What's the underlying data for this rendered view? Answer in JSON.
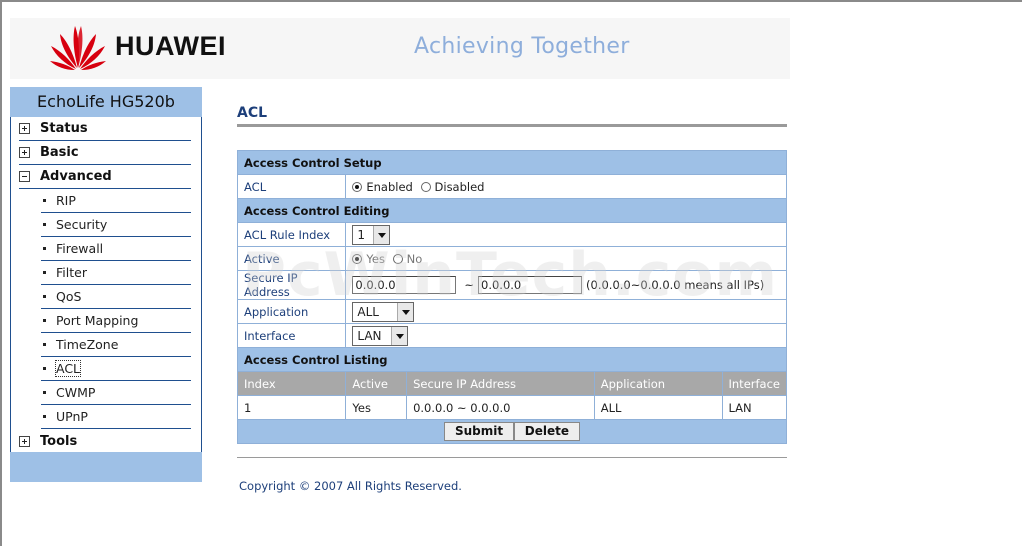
{
  "header": {
    "brand": "HUAWEI",
    "tagline": "Achieving Together"
  },
  "sidebar": {
    "model": "EchoLife HG520b",
    "top_items": [
      {
        "label": "Status",
        "state": "collapsed"
      },
      {
        "label": "Basic",
        "state": "collapsed"
      },
      {
        "label": "Advanced",
        "state": "expanded"
      },
      {
        "label": "Tools",
        "state": "collapsed"
      }
    ],
    "advanced_items": [
      "RIP",
      "Security",
      "Firewall",
      "Filter",
      "QoS",
      "Port Mapping",
      "TimeZone",
      "ACL",
      "CWMP",
      "UPnP"
    ],
    "selected": "ACL"
  },
  "page": {
    "title": "ACL",
    "setup_section": "Access Control Setup",
    "acl_label": "ACL",
    "acl_enabled": "Enabled",
    "acl_disabled": "Disabled",
    "acl_value": "Enabled",
    "editing_section": "Access Control Editing",
    "rule_index_label": "ACL Rule Index",
    "rule_index_value": "1",
    "active_label": "Active",
    "active_yes": "Yes",
    "active_no": "No",
    "active_value": "Yes",
    "secure_ip_label": "Secure IP Address",
    "ip_start": "0.0.0.0",
    "ip_separator": "~",
    "ip_end": "0.0.0.0",
    "ip_hint": "(0.0.0.0~0.0.0.0 means all IPs)",
    "application_label": "Application",
    "application_value": "ALL",
    "interface_label": "Interface",
    "interface_value": "LAN",
    "listing_section": "Access Control Listing",
    "listing_columns": [
      "Index",
      "Active",
      "Secure IP Address",
      "Application",
      "Interface"
    ],
    "listing_rows": [
      [
        "1",
        "Yes",
        "0.0.0.0 ~ 0.0.0.0",
        "ALL",
        "LAN"
      ]
    ],
    "submit_label": "Submit",
    "delete_label": "Delete"
  },
  "footer": {
    "copyright": "Copyright © 2007 All Rights Reserved."
  },
  "watermark": "PcWinTech.com",
  "colors": {
    "section_blue": "#9ec0e6",
    "label_navy": "#1d3f7a",
    "list_header_gray": "#a8a8a8",
    "tagline_blue": "#8eaedb",
    "logo_red": "#d7000f"
  }
}
